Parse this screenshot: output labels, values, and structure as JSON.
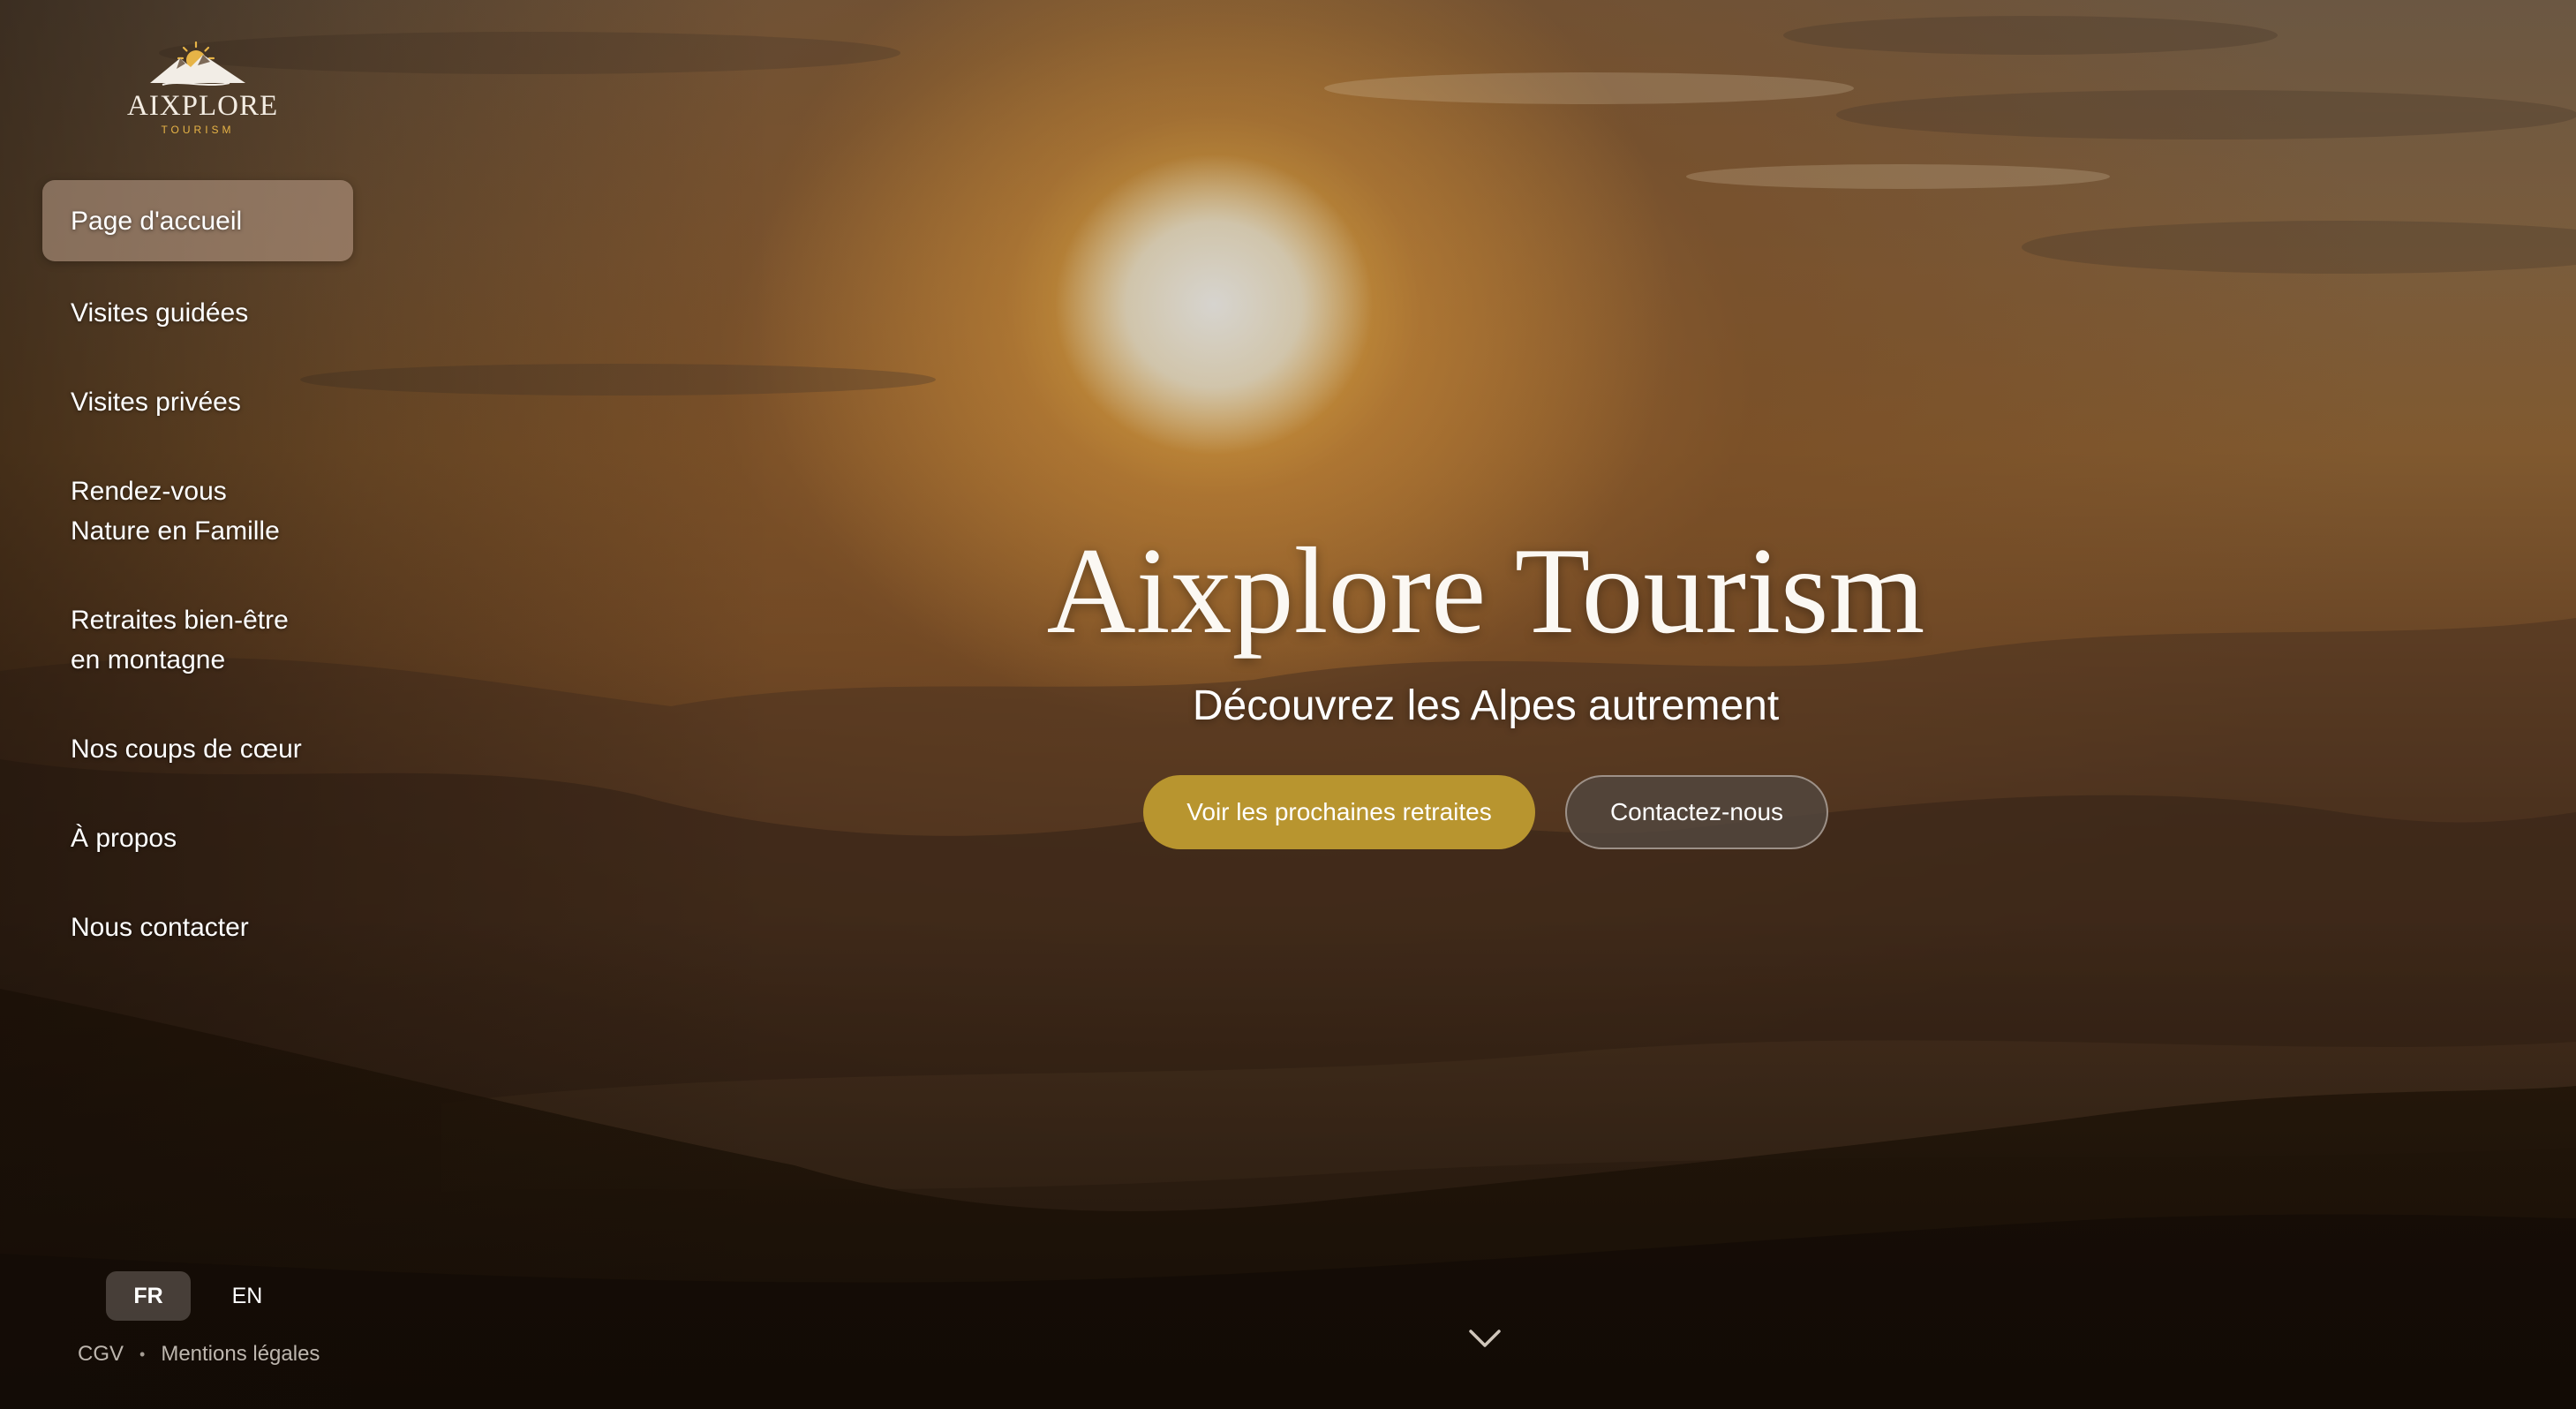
{
  "brand": {
    "name": "AIXPLORE",
    "tagline": "TOURISM",
    "accent_color": "#e7b447"
  },
  "sidebar": {
    "items": [
      {
        "label": "Page d'accueil",
        "active": true
      },
      {
        "label": "Visites guidées",
        "active": false
      },
      {
        "label": "Visites privées",
        "active": false
      },
      {
        "label": "Rendez-vous Nature en Famille",
        "active": false
      },
      {
        "label": "Retraites bien-être en montagne",
        "active": false
      },
      {
        "label": "Nos coups de cœur",
        "active": false
      },
      {
        "label": "À propos",
        "active": false
      },
      {
        "label": "Nous contacter",
        "active": false
      }
    ],
    "languages": [
      {
        "code": "FR",
        "active": true
      },
      {
        "code": "EN",
        "active": false
      }
    ],
    "legal": {
      "cgv": "CGV",
      "separator": "•",
      "mentions": "Mentions légales"
    }
  },
  "hero": {
    "title": "Aixplore Tourism",
    "subtitle": "Découvrez les Alpes autrement",
    "primary_button": "Voir les prochaines retraites",
    "secondary_button": "Contactez-nous",
    "primary_color": "#b8952f",
    "scroll_icon": "chevron-down-icon"
  }
}
